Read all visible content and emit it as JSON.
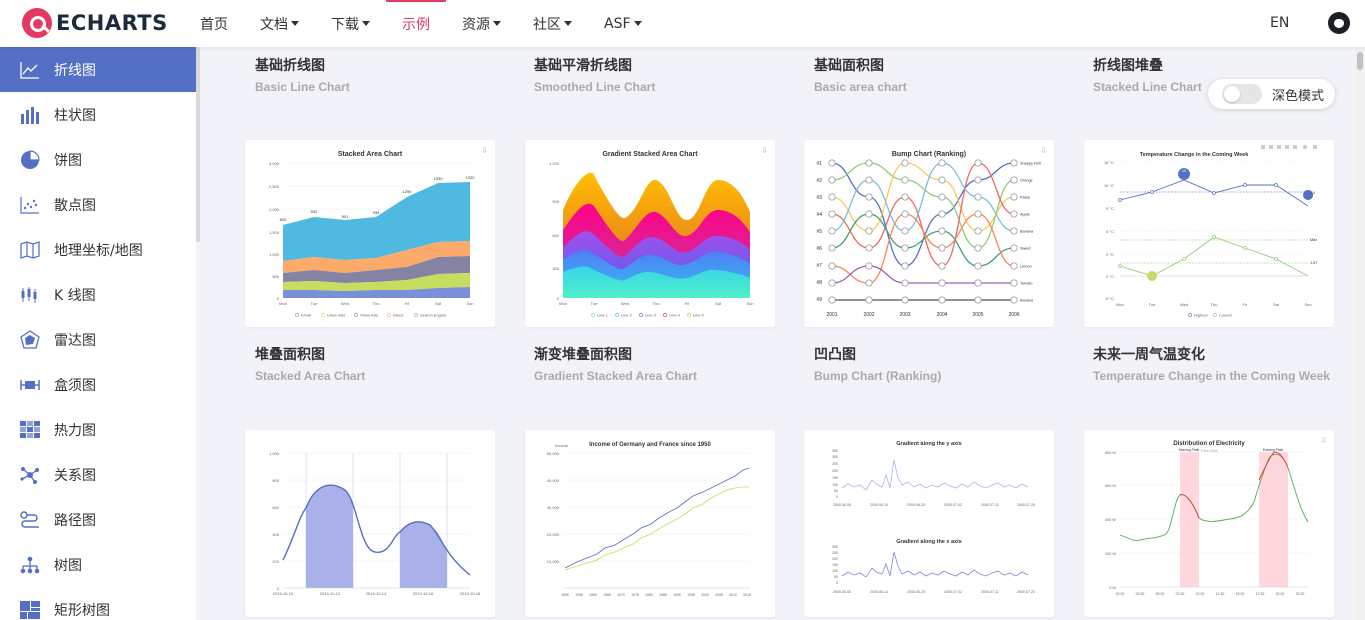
{
  "brand": {
    "name": "ECHARTS",
    "color": "#e43961"
  },
  "nav": {
    "items": [
      {
        "label": "首页",
        "dropdown": false,
        "active": false
      },
      {
        "label": "文档",
        "dropdown": true,
        "active": false
      },
      {
        "label": "下载",
        "dropdown": true,
        "active": false
      },
      {
        "label": "示例",
        "dropdown": false,
        "active": true
      },
      {
        "label": "资源",
        "dropdown": true,
        "active": false
      },
      {
        "label": "社区",
        "dropdown": true,
        "active": false
      },
      {
        "label": "ASF",
        "dropdown": true,
        "active": false
      }
    ],
    "lang": "EN",
    "github_icon": "github-icon"
  },
  "sidebar": {
    "accent": "#5470c6",
    "items": [
      {
        "label": "折线图",
        "icon": "line-chart-icon",
        "active": true
      },
      {
        "label": "柱状图",
        "icon": "bar-chart-icon",
        "active": false
      },
      {
        "label": "饼图",
        "icon": "pie-chart-icon",
        "active": false
      },
      {
        "label": "散点图",
        "icon": "scatter-chart-icon",
        "active": false
      },
      {
        "label": "地理坐标/地图",
        "icon": "map-icon",
        "active": false
      },
      {
        "label": "K 线图",
        "icon": "candlestick-icon",
        "active": false
      },
      {
        "label": "雷达图",
        "icon": "radar-icon",
        "active": false
      },
      {
        "label": "盒须图",
        "icon": "boxplot-icon",
        "active": false
      },
      {
        "label": "热力图",
        "icon": "heatmap-icon",
        "active": false
      },
      {
        "label": "关系图",
        "icon": "graph-icon",
        "active": false
      },
      {
        "label": "路径图",
        "icon": "lines-icon",
        "active": false
      },
      {
        "label": "树图",
        "icon": "tree-icon",
        "active": false
      },
      {
        "label": "矩形树图",
        "icon": "treemap-icon",
        "active": false
      }
    ]
  },
  "dark_mode": {
    "label": "深色模式",
    "enabled": false
  },
  "rows": [
    {
      "titles": [
        {
          "title": "基础折线图",
          "subtitle": "Basic Line Chart"
        },
        {
          "title": "基础平滑折线图",
          "subtitle": "Smoothed Line Chart"
        },
        {
          "title": "基础面积图",
          "subtitle": "Basic area chart"
        },
        {
          "title": "折线图堆叠",
          "subtitle": "Stacked Line Chart"
        }
      ]
    },
    {
      "titles": [
        {
          "title": "堆叠面积图",
          "subtitle": "Stacked Area Chart"
        },
        {
          "title": "渐变堆叠面积图",
          "subtitle": "Gradient Stacked Area Chart"
        },
        {
          "title": "凹凸图",
          "subtitle": "Bump Chart (Ranking)"
        },
        {
          "title": "未来一周气温变化",
          "subtitle": "Temperature Change in the Coming Week"
        }
      ]
    }
  ],
  "thumbs": {
    "stacked_area": {
      "title": "Stacked Area Chart",
      "days": [
        "Mon",
        "Tue",
        "Wed",
        "Thu",
        "Fri",
        "Sat",
        "Sun"
      ],
      "yticks": [
        "0",
        "500",
        "1,000",
        "1,500",
        "2,000",
        "2,500",
        "3,000"
      ],
      "top_labels": [
        "820",
        "932",
        "901",
        "934",
        "1290",
        "1330",
        "1320"
      ],
      "legend": [
        "Email",
        "Union Ads",
        "Video Ads",
        "Direct",
        "Search Engine"
      ]
    },
    "gradient_area": {
      "title": "Gradient Stacked Area Chart",
      "days": [
        "Mon",
        "Tue",
        "Wed",
        "Thu",
        "Fri",
        "Sat",
        "Sun"
      ],
      "yticks": [
        "0",
        "300",
        "600",
        "900",
        "1,200"
      ],
      "legend": [
        "Line 1",
        "Line 2",
        "Line 3",
        "Line 4",
        "Line 5"
      ]
    },
    "bump": {
      "title": "Bump Chart (Ranking)",
      "years": [
        "2001",
        "2002",
        "2003",
        "2004",
        "2005",
        "2006"
      ],
      "ranks": [
        "#1",
        "#2",
        "#3",
        "#4",
        "#5",
        "#6",
        "#7",
        "#8",
        "#9"
      ],
      "names": [
        "Snappy Fish",
        "Orange",
        "Pasta",
        "Apple",
        "Banana",
        "Sweet",
        "Lemon",
        "Tomato",
        "Banana"
      ]
    },
    "temperature": {
      "title": "Temperature Change in the Coming Week",
      "days": [
        "Mon",
        "Tue",
        "Wed",
        "Thu",
        "Fri",
        "Sat",
        "Sun"
      ],
      "yticks": [
        "-5 °C",
        "0 °C",
        "5 °C",
        "10 °C",
        "15 °C"
      ],
      "legend": [
        "Highest",
        "Lowest"
      ],
      "labels": [
        "Max",
        "1.57",
        "13",
        "14"
      ]
    },
    "area_pieces": {
      "xticks": [
        "2019-10-10",
        "2019-10-12",
        "2019-10-14",
        "2019-10-16",
        "2019-10-18"
      ],
      "yticks": [
        "0",
        "200",
        "400",
        "600",
        "800",
        "1,000"
      ]
    },
    "income": {
      "title": "Income of Germany and France since 1950",
      "ylabel": "Income",
      "yticks": [
        "10,000",
        "20,000",
        "30,000",
        "40,000",
        "50,000"
      ],
      "xticks": [
        "1950",
        "1955",
        "1960",
        "1965",
        "1970",
        "1975",
        "1980",
        "1985",
        "1990",
        "1995",
        "2000",
        "2005",
        "2010",
        "2015"
      ]
    },
    "gradient_axis": {
      "title_y": "Gradient along the y axis",
      "title_x": "Gradient along the x axis",
      "yticks": [
        "0",
        "50",
        "100",
        "150",
        "200",
        "250",
        "300",
        "350"
      ],
      "xticks": [
        "2000-06-05",
        "2000-06-14",
        "2000-06-23",
        "2000-07-02",
        "2000-07-11",
        "2000-07-20"
      ]
    },
    "electricity": {
      "title": "Distribution of Electricity",
      "subtitle": "Fake Data",
      "yticks": [
        "0 W",
        "200 W",
        "400 W",
        "600 W",
        "800 W"
      ],
      "xticks": [
        "00:00",
        "02:30",
        "05:00",
        "07:30",
        "10:00",
        "12:30",
        "15:00",
        "17:30",
        "20:00",
        "22:30"
      ],
      "peaks": [
        "Morning Peak",
        "Evening Peak"
      ]
    }
  }
}
